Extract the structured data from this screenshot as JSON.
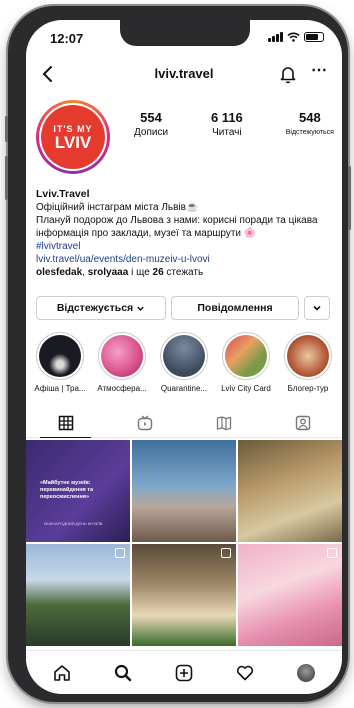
{
  "status": {
    "time": "12:07"
  },
  "header": {
    "username": "lviv.travel"
  },
  "profile": {
    "logo_line1": "IT'S MY",
    "logo_line2": "LVIV",
    "stats": [
      {
        "value": "554",
        "label": "Дописи"
      },
      {
        "value": "6 116",
        "label": "Читачі"
      },
      {
        "value": "548",
        "label": "Відстежуються"
      }
    ],
    "name": "Lviv.Travel",
    "bio_line1": "Офіційний інстаграм міста Львів☕",
    "bio_line2": "Плануй подорож до Львова з нами: корисні поради та цікава інформація про заклади, музеї та маршрути 🌸",
    "hashtag": "#lvivtravel",
    "link": "lviv.travel/ua/events/den-muzeiv-u-lvovi",
    "followed_by_names": "olesfedak",
    "followed_by_sep": ", ",
    "followed_by_names2": "srolyaaa",
    "followed_by_mid": " і ще ",
    "followed_by_count": "26",
    "followed_by_suffix": " стежать"
  },
  "actions": {
    "follow_label": "Відстежується",
    "message_label": "Повідомлення"
  },
  "highlights": [
    {
      "label": "Афіша | Тра...",
      "color": "#1a1a22"
    },
    {
      "label": "Атмосфера...",
      "color": "#d94f8a"
    },
    {
      "label": "Quarantine...",
      "color": "#3c4a5c"
    },
    {
      "label": "Lviv City Card",
      "color": "#7a9a4a"
    },
    {
      "label": "Блогер-тур",
      "color": "#b85a3a"
    }
  ],
  "grid": {
    "poster_title": "«Майбутнє музеїв: перевинайдення та переосмислення»",
    "poster_sub": "МІЖНАРОДНИЙ ДЕНЬ МУЗЕЇВ",
    "cells": [
      {
        "bg": "linear-gradient(135deg,#3b2a6e,#5b3d9a 60%,#2a1f55)",
        "multi": false
      },
      {
        "bg": "linear-gradient(180deg,#3f6f9a 0%,#7fa7c8 45%,#b8a79a 65%,#6f5a4a 100%)",
        "multi": false
      },
      {
        "bg": "linear-gradient(160deg,#6b5a3a,#b89a6a 40%,#d8c8a0 70%,#7a6a4a)",
        "multi": false
      },
      {
        "bg": "linear-gradient(180deg,#9ab8d8 0%,#c8d8e8 35%,#4a6a3a 60%,#2a3a2a 100%)",
        "multi": true
      },
      {
        "bg": "linear-gradient(180deg,#5a4a3a,#a08868 40%,#e8d8b8 70%,#3a6a2a)",
        "multi": true
      },
      {
        "bg": "linear-gradient(160deg,#f0b0c8,#f8d8e0 40%,#e890b0 70%,#c86a88)",
        "multi": true
      }
    ]
  }
}
